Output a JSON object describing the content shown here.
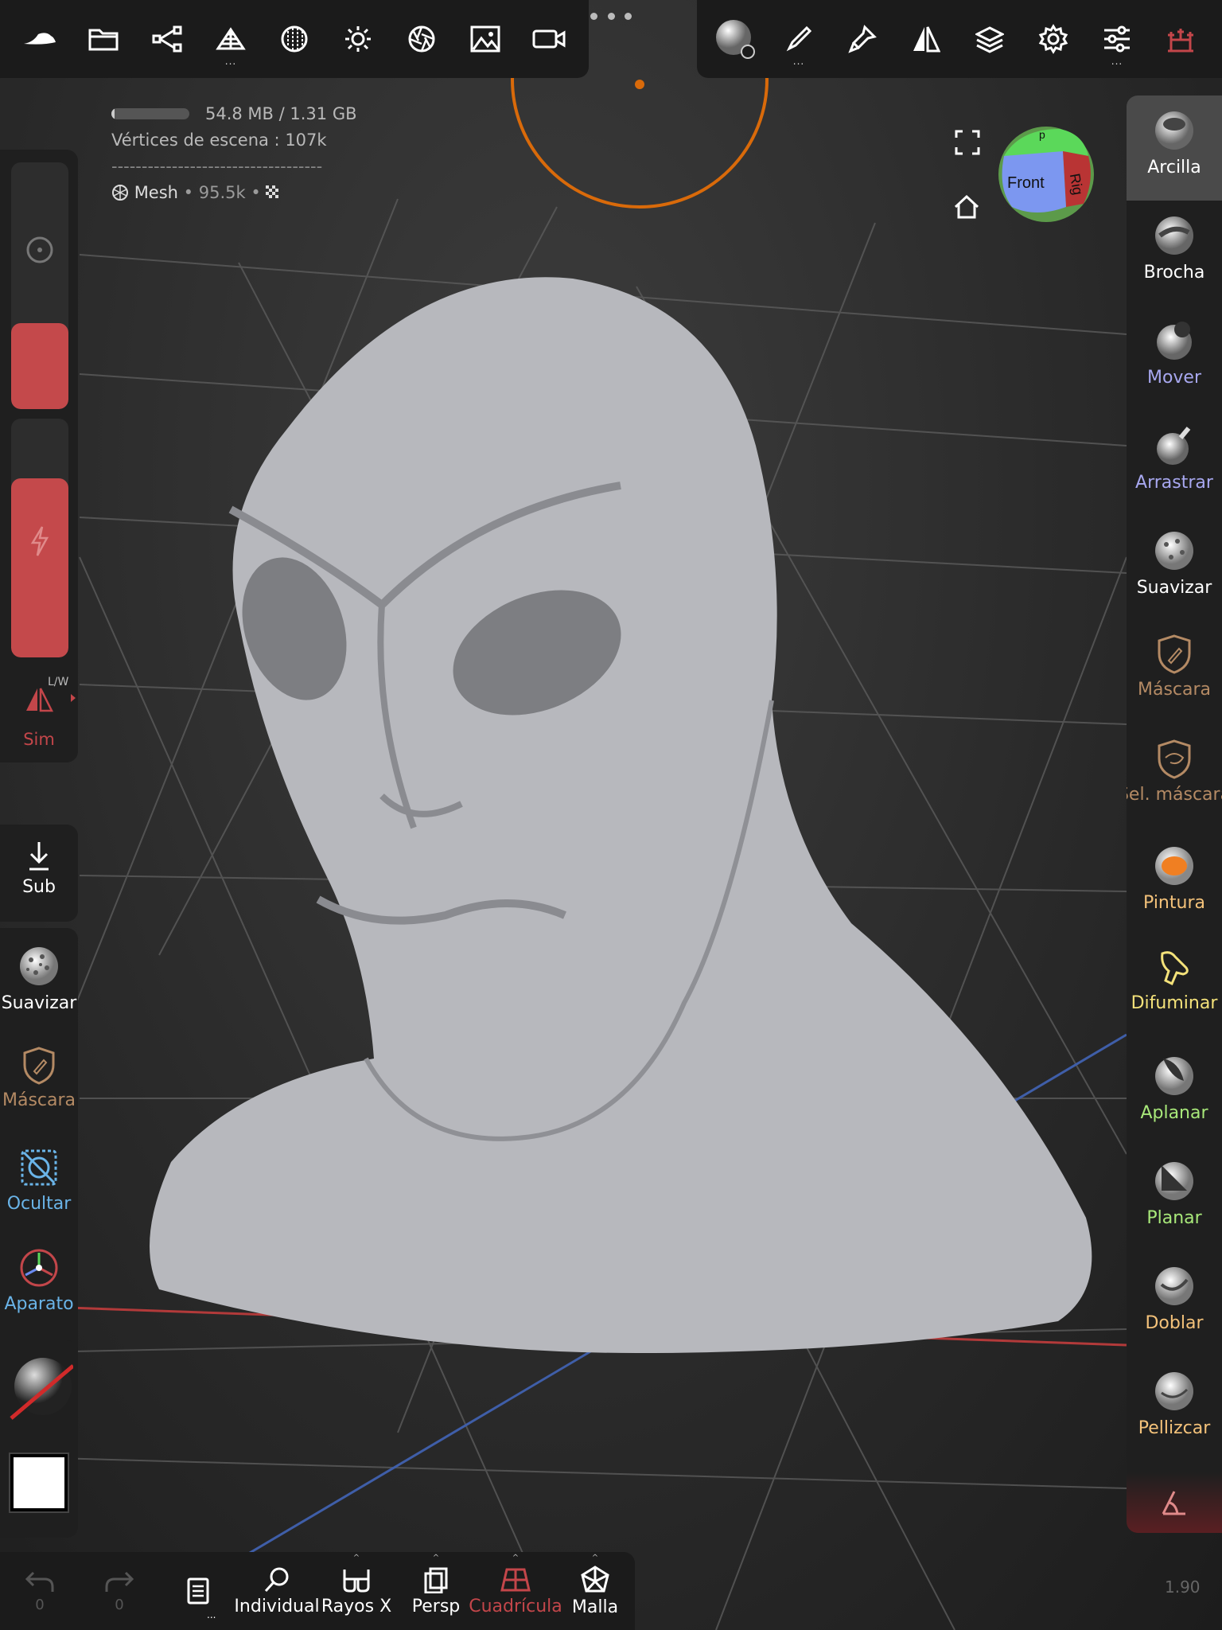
{
  "stats": {
    "memory": "54.8 MB / 1.31 GB",
    "memory_fraction": 0.04,
    "scene_vertices_label": "Vértices de escena :",
    "scene_vertices_value": "107k",
    "separator": "-----------------------------------",
    "mesh_name": "Mesh",
    "mesh_count": "• 95.5k •"
  },
  "gizmo": {
    "front": "Front",
    "right": "Rig",
    "top": "p"
  },
  "top_toolbar_left": {
    "more": "...",
    "icons": [
      "nomad-logo-icon",
      "folder-icon",
      "scene-graph-icon",
      "topology-icon",
      "material-icon",
      "light-icon",
      "post-process-icon",
      "background-image-icon",
      "video-icon"
    ]
  },
  "top_toolbar_right": {
    "icons": [
      "clay-sphere-icon",
      "stroke-icon",
      "paint-brush-icon",
      "symmetry-icon",
      "layers-icon",
      "settings-icon",
      "sliders-icon",
      "tool-settings-icon"
    ]
  },
  "left_panel": {
    "symmetry_label": "Sim",
    "symmetry_hint": "L/W",
    "radius_fraction": 0.35,
    "intensity_fraction": 0.75
  },
  "left_tools": [
    {
      "label": "Sub",
      "icon": "download-arrow-icon",
      "color": "#ffffff"
    },
    {
      "label": "Suavizar",
      "icon": "smooth-sphere-icon",
      "color": "#ffffff"
    },
    {
      "label": "Máscara",
      "icon": "mask-shield-icon",
      "color": "#b48a64"
    },
    {
      "label": "Ocultar",
      "icon": "hide-icon",
      "color": "#6ab4e8"
    },
    {
      "label": "Aparato",
      "icon": "gizmo-icon",
      "color": "#6ab4e8"
    }
  ],
  "right_tools": [
    {
      "label": "Arcilla",
      "icon": "clay-icon",
      "color": "#ffffff",
      "active": true
    },
    {
      "label": "Brocha",
      "icon": "brush-icon",
      "color": "#ffffff"
    },
    {
      "label": "Mover",
      "icon": "move-icon",
      "color": "#a8a8f0"
    },
    {
      "label": "Arrastrar",
      "icon": "drag-icon",
      "color": "#a8a8f0"
    },
    {
      "label": "Suavizar",
      "icon": "smooth-icon",
      "color": "#ffffff"
    },
    {
      "label": "Máscara",
      "icon": "mask-icon",
      "color": "#b48a64"
    },
    {
      "label": "Sel. máscara",
      "icon": "select-mask-icon",
      "color": "#b48a64"
    },
    {
      "label": "Pintura",
      "icon": "paint-icon",
      "color": "#f4c27a"
    },
    {
      "label": "Difuminar",
      "icon": "smudge-icon",
      "color": "#f4e27a"
    },
    {
      "label": "Aplanar",
      "icon": "flatten-icon",
      "color": "#a8e87a"
    },
    {
      "label": "Planar",
      "icon": "planar-icon",
      "color": "#a8e87a"
    },
    {
      "label": "Doblar",
      "icon": "crease-icon",
      "color": "#f4c27a"
    },
    {
      "label": "Pellizcar",
      "icon": "pinch-icon",
      "color": "#f4c27a"
    }
  ],
  "bottom_bar": {
    "undo_count": "0",
    "redo_count": "0",
    "more": "...",
    "items": [
      {
        "label": "Individual",
        "icon": "search-icon",
        "color": "#ffffff"
      },
      {
        "label": "Rayos X",
        "icon": "xray-glasses-icon",
        "color": "#ffffff"
      },
      {
        "label": "Persp",
        "icon": "perspective-icon",
        "color": "#ffffff"
      },
      {
        "label": "Cuadrícula",
        "icon": "grid-icon",
        "color": "#c3464a"
      },
      {
        "label": "Malla",
        "icon": "wireframe-icon",
        "color": "#ffffff"
      }
    ]
  },
  "version": "1.90"
}
